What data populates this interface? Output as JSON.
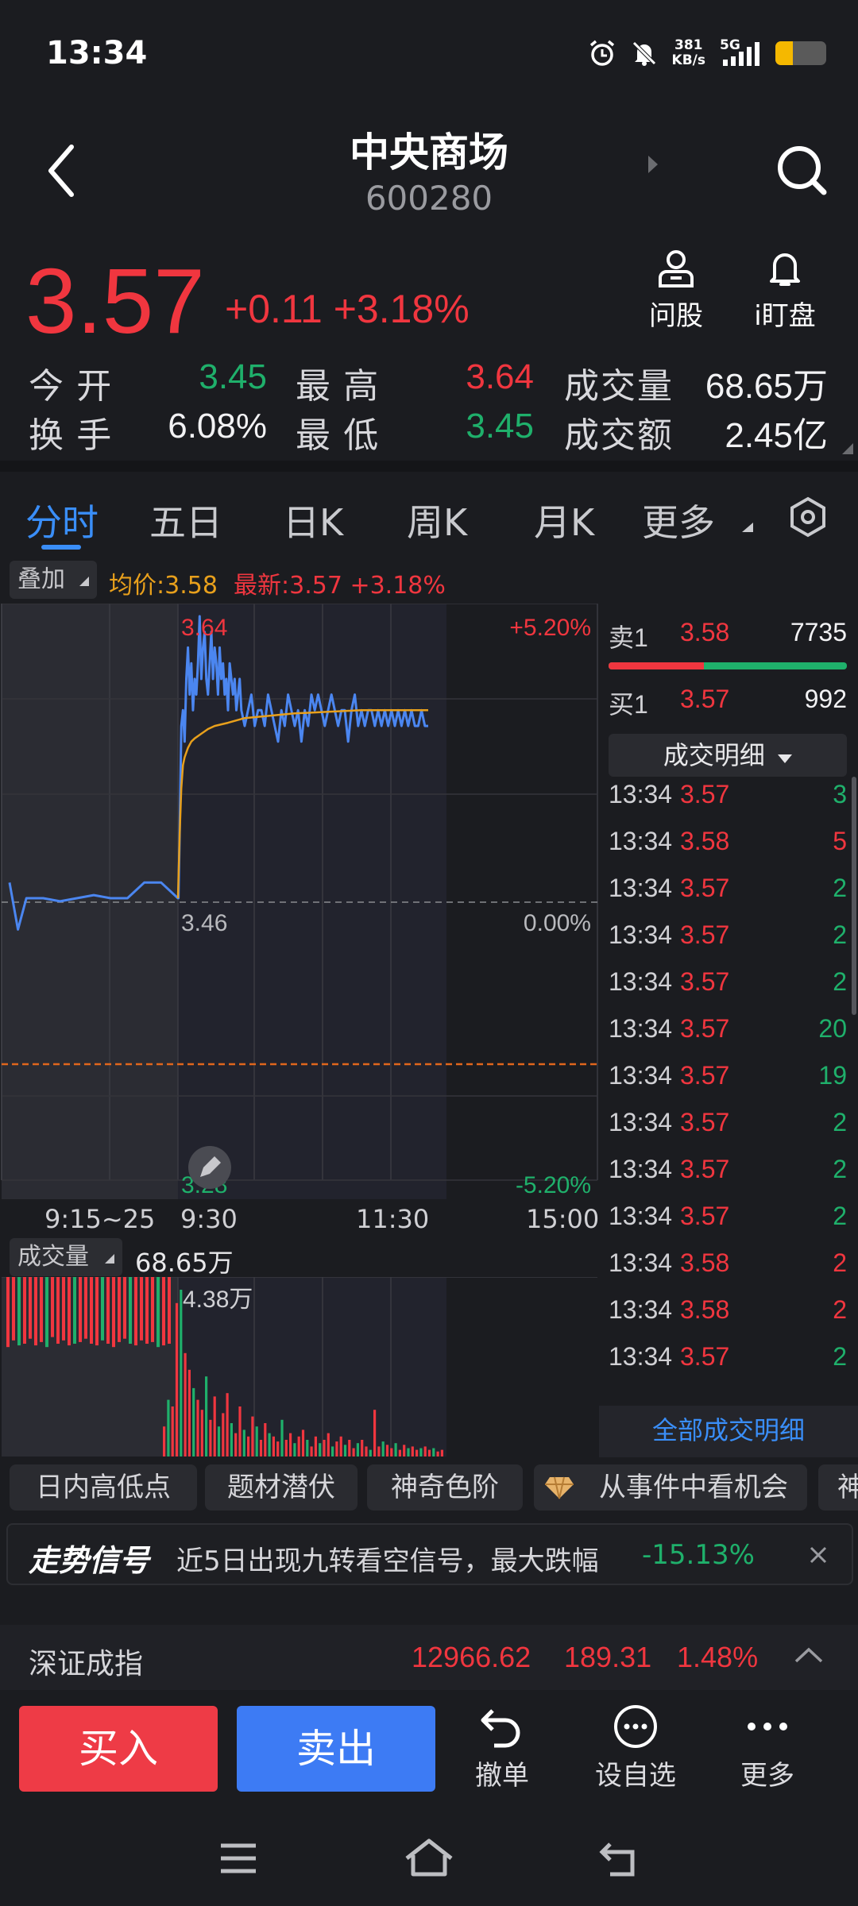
{
  "status_bar": {
    "time": "13:34",
    "net_speed_value": "381",
    "net_speed_unit": "KB/s",
    "network": "5G",
    "battery_level": 0.35
  },
  "header": {
    "stock_name": "中央商场",
    "stock_code": "600280"
  },
  "quote": {
    "price": "3.57",
    "change": "+0.11",
    "change_pct": "+3.18%",
    "ask_stock_label": "问股",
    "watch_label": "i盯盘",
    "open_label": "今 开",
    "open": "3.45",
    "high_label": "最 高",
    "high": "3.64",
    "volume_label": "成交量",
    "volume": "68.65万",
    "turnover_rate_label": "换 手",
    "turnover_rate": "6.08%",
    "low_label": "最 低",
    "low": "3.45",
    "amount_label": "成交额",
    "amount": "2.45亿"
  },
  "tabs": [
    {
      "label": "分时",
      "active": true
    },
    {
      "label": "五日"
    },
    {
      "label": "日K"
    },
    {
      "label": "周K"
    },
    {
      "label": "月K"
    },
    {
      "label": "更多"
    }
  ],
  "overlay": {
    "label": "叠加",
    "avg_price": "均价:3.58",
    "latest": "最新:3.57 +3.18%"
  },
  "chart_data": {
    "type": "line",
    "price_labels": {
      "top": "3.64",
      "prev_close": "3.46",
      "bottom": "3.28"
    },
    "pct_labels": {
      "top": "+5.20%",
      "mid": "0.00%",
      "bottom": "-5.20%"
    },
    "x_ticks": [
      "9:15~25",
      "9:30",
      "11:30",
      "15:00"
    ],
    "ylim": [
      3.28,
      3.64
    ],
    "prev_close": 3.46,
    "series": [
      {
        "name": "",
        "color": "#4b86f0",
        "x": [
          0,
          0.5,
          1,
          2,
          3,
          4,
          5,
          6,
          7,
          8,
          9,
          10,
          10.3,
          11,
          12,
          13,
          14,
          15,
          16,
          17,
          18,
          19,
          20,
          21,
          22,
          23,
          24,
          25,
          26,
          27,
          28,
          29,
          30,
          31,
          32,
          33,
          34,
          35,
          36,
          37,
          38,
          39,
          40,
          41,
          42,
          43,
          44,
          45,
          46,
          47,
          48,
          50,
          52,
          54,
          56,
          58,
          60,
          62,
          64,
          66,
          68,
          70,
          72,
          74,
          76,
          78,
          80,
          82,
          84,
          86,
          88,
          90,
          92,
          94,
          96,
          98,
          100,
          102,
          104,
          106,
          108,
          110,
          112,
          114,
          116,
          118,
          120,
          122,
          124,
          126,
          128,
          130,
          132,
          134,
          136,
          138,
          140,
          142,
          144,
          146,
          148,
          150,
          152,
          154,
          156,
          158,
          160
        ],
        "y": [
          3.47,
          3.44,
          3.46,
          3.46,
          3.458,
          3.46,
          3.462,
          3.46,
          3.46,
          3.47,
          3.47,
          3.46,
          3.46,
          3.5,
          3.57,
          3.58,
          3.56,
          3.6,
          3.62,
          3.59,
          3.61,
          3.58,
          3.6,
          3.59,
          3.61,
          3.64,
          3.6,
          3.62,
          3.63,
          3.6,
          3.59,
          3.61,
          3.63,
          3.6,
          3.62,
          3.61,
          3.59,
          3.62,
          3.6,
          3.61,
          3.59,
          3.6,
          3.58,
          3.61,
          3.6,
          3.59,
          3.6,
          3.58,
          3.59,
          3.6,
          3.58,
          3.57,
          3.58,
          3.59,
          3.57,
          3.58,
          3.58,
          3.57,
          3.59,
          3.58,
          3.57,
          3.56,
          3.58,
          3.57,
          3.59,
          3.58,
          3.57,
          3.58,
          3.56,
          3.58,
          3.57,
          3.59,
          3.58,
          3.59,
          3.58,
          3.57,
          3.58,
          3.59,
          3.58,
          3.57,
          3.58,
          3.58,
          3.56,
          3.58,
          3.59,
          3.57,
          3.58,
          3.57,
          3.58,
          3.58,
          3.57,
          3.58,
          3.57,
          3.58,
          3.57,
          3.58,
          3.57,
          3.58,
          3.57,
          3.58,
          3.57,
          3.58,
          3.57,
          3.57,
          3.58,
          3.57,
          3.57
        ]
      },
      {
        "name": "",
        "color": "#e8a01c",
        "x": [
          10,
          11,
          12,
          13,
          14,
          16,
          18,
          20,
          24,
          28,
          32,
          40,
          50,
          60,
          70,
          80,
          100,
          120,
          140,
          160
        ],
        "y": [
          3.46,
          3.5,
          3.53,
          3.545,
          3.55,
          3.556,
          3.56,
          3.562,
          3.565,
          3.568,
          3.57,
          3.572,
          3.575,
          3.576,
          3.577,
          3.578,
          3.579,
          3.58,
          3.58,
          3.58
        ]
      }
    ],
    "x_range": [
      0,
      330
    ]
  },
  "volume_panel": {
    "label": "成交量",
    "total": "68.65万",
    "max_label": "4.38万"
  },
  "volume_data": {
    "pre": [
      0.42,
      0.38,
      0.41,
      0.4,
      0.37,
      0.41,
      0.39,
      0.42,
      0.36,
      0.4,
      0.38,
      0.41,
      0.4,
      0.39,
      0.37,
      0.4,
      0.41,
      0.38,
      0.4,
      0.42,
      0.39,
      0.37,
      0.4,
      0.41,
      0.38,
      0.4,
      0.39,
      0.42,
      0.41,
      0.4
    ],
    "post": [
      0.18,
      0.34,
      0.3,
      0.92,
      1.0,
      0.62,
      0.52,
      0.41,
      0.34,
      0.28,
      0.48,
      0.22,
      0.36,
      0.18,
      0.26,
      0.38,
      0.2,
      0.14,
      0.3,
      0.16,
      0.12,
      0.24,
      0.18,
      0.1,
      0.2,
      0.14,
      0.12,
      0.09,
      0.22,
      0.1,
      0.14,
      0.08,
      0.12,
      0.16,
      0.1,
      0.06,
      0.12,
      0.08,
      0.1,
      0.14,
      0.06,
      0.09,
      0.12,
      0.07,
      0.1,
      0.05,
      0.08,
      0.1,
      0.06,
      0.04,
      0.28,
      0.06,
      0.09,
      0.07,
      0.05,
      0.08,
      0.04,
      0.07,
      0.05,
      0.06,
      0.04,
      0.05,
      0.06,
      0.04,
      0.05,
      0.03,
      0.04
    ]
  },
  "order_book": {
    "ask": {
      "label": "卖1",
      "price": "3.58",
      "volume": "7735"
    },
    "bid": {
      "label": "买1",
      "price": "3.57",
      "volume": "992"
    },
    "ask_ratio": 0.4,
    "detail_dropdown": "成交明细",
    "trades": [
      {
        "time": "13:34",
        "price": "3.57",
        "vol": "3",
        "side": "buy"
      },
      {
        "time": "13:34",
        "price": "3.58",
        "vol": "5",
        "side": "sell"
      },
      {
        "time": "13:34",
        "price": "3.57",
        "vol": "2",
        "side": "buy"
      },
      {
        "time": "13:34",
        "price": "3.57",
        "vol": "2",
        "side": "buy"
      },
      {
        "time": "13:34",
        "price": "3.57",
        "vol": "2",
        "side": "buy"
      },
      {
        "time": "13:34",
        "price": "3.57",
        "vol": "20",
        "side": "buy"
      },
      {
        "time": "13:34",
        "price": "3.57",
        "vol": "19",
        "side": "buy"
      },
      {
        "time": "13:34",
        "price": "3.57",
        "vol": "2",
        "side": "buy"
      },
      {
        "time": "13:34",
        "price": "3.57",
        "vol": "2",
        "side": "buy"
      },
      {
        "time": "13:34",
        "price": "3.57",
        "vol": "2",
        "side": "buy"
      },
      {
        "time": "13:34",
        "price": "3.58",
        "vol": "2",
        "side": "sell"
      },
      {
        "time": "13:34",
        "price": "3.58",
        "vol": "2",
        "side": "sell"
      },
      {
        "time": "13:34",
        "price": "3.57",
        "vol": "2",
        "side": "buy"
      }
    ],
    "all_details_link": "全部成交明细"
  },
  "chips": [
    "日内高低点",
    "题材潜伏",
    "神奇色阶",
    "从事件中看机会",
    "神"
  ],
  "signal": {
    "title": "走势信号",
    "text": "近5日出现九转看空信号，最大跌幅",
    "pct": "-15.13%"
  },
  "index_bar": {
    "name": "深证成指",
    "value": "12966.62",
    "change": "189.31",
    "pct": "1.48%"
  },
  "actions": {
    "buy": "买入",
    "sell": "卖出",
    "cancel": "撤单",
    "set_watch": "设自选",
    "more": "更多"
  },
  "colors": {
    "up": "#f0363f",
    "down": "#1fb06b",
    "accent": "#3a8ef8",
    "avg_line": "#e8a01c",
    "price_line": "#4b86f0"
  }
}
